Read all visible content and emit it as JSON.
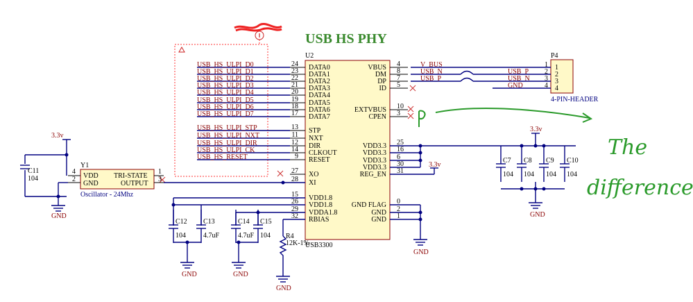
{
  "title": "USB HS PHY",
  "annotation": {
    "lines": [
      "The",
      "difference!"
    ],
    "marker": "p"
  },
  "u2": {
    "ref": "U2",
    "part": "USB3300",
    "left_pins": [
      {
        "num": "24",
        "name": "DATA0",
        "net": "USB_HS_ULPI_D0"
      },
      {
        "num": "23",
        "name": "DATA1",
        "net": "USB_HS_ULPI_D1"
      },
      {
        "num": "22",
        "name": "DATA2",
        "net": "USB_HS_ULPI_D2"
      },
      {
        "num": "21",
        "name": "DATA3",
        "net": "USB_HS_ULPI_D3"
      },
      {
        "num": "20",
        "name": "DATA4",
        "net": "USB_HS_ULPI_D4"
      },
      {
        "num": "19",
        "name": "DATA5",
        "net": "USB_HS_ULPI_D5"
      },
      {
        "num": "18",
        "name": "DATA6",
        "net": "USB_HS_ULPI_D6"
      },
      {
        "num": "17",
        "name": "DATA7",
        "net": "USB_HS_ULPI_D7"
      },
      {
        "num": "13",
        "name": "STP",
        "net": "USB_HS_ULPI_STP"
      },
      {
        "num": "11",
        "name": "NXT",
        "net": "USB_HS_ULPI_NXT"
      },
      {
        "num": "12",
        "name": "DIR",
        "net": "USB_HS_ULPI_DIR"
      },
      {
        "num": "14",
        "name": "CLKOUT",
        "net": "USB_HS_ULPI_CK"
      },
      {
        "num": "9",
        "name": "RESET",
        "net": "USB_HS_RESET"
      },
      {
        "num": "27",
        "name": "XO",
        "net": ""
      },
      {
        "num": "28",
        "name": "XI",
        "net": ""
      },
      {
        "num": "15",
        "name": "VDD1.8",
        "net": ""
      },
      {
        "num": "26",
        "name": "VDD1.8",
        "net": ""
      },
      {
        "num": "29",
        "name": "VDDA1.8",
        "net": ""
      },
      {
        "num": "32",
        "name": "RBIAS",
        "net": ""
      }
    ],
    "right_pins": [
      {
        "num": "4",
        "name": "VBUS",
        "net": "V_BUS"
      },
      {
        "num": "8",
        "name": "DM",
        "net": "USB_N"
      },
      {
        "num": "7",
        "name": "DP",
        "net": "USB_P"
      },
      {
        "num": "5",
        "name": "ID",
        "net": ""
      },
      {
        "num": "10",
        "name": "EXTVBUS",
        "net": ""
      },
      {
        "num": "3",
        "name": "CPEN",
        "net": ""
      },
      {
        "num": "25",
        "name": "VDD3.3",
        "net": ""
      },
      {
        "num": "16",
        "name": "VDD3.3",
        "net": ""
      },
      {
        "num": "6",
        "name": "VDD3.3",
        "net": ""
      },
      {
        "num": "30",
        "name": "VDD3.3",
        "net": ""
      },
      {
        "num": "31",
        "name": "REG_EN",
        "net": ""
      },
      {
        "num": "0",
        "name": "GND FLAG",
        "net": ""
      },
      {
        "num": "2",
        "name": "GND",
        "net": ""
      },
      {
        "num": "1",
        "name": "GND",
        "net": ""
      }
    ]
  },
  "p4": {
    "ref": "P4",
    "part": "4-PIN-HEADER",
    "pins": [
      {
        "num": "1",
        "pin": "1",
        "net": ""
      },
      {
        "num": "2",
        "pin": "2",
        "net": "USB_P"
      },
      {
        "num": "3",
        "pin": "3",
        "net": "USB_N"
      },
      {
        "num": "4",
        "pin": "4",
        "net": "GND"
      }
    ]
  },
  "y1": {
    "ref": "Y1",
    "part": "Oscillator - 24Mhz",
    "vdd": "VDD",
    "gnd": "GND",
    "tri": "TRI-STATE",
    "out": "OUTPUT",
    "pin_vdd": "4",
    "pin_gnd": "2",
    "pin_tri": "1",
    "pin_out": "3"
  },
  "c11": {
    "ref": "C11",
    "value": "104"
  },
  "caps_bottom": [
    {
      "ref": "C12",
      "value": "104"
    },
    {
      "ref": "C13",
      "value": "4.7uF"
    },
    {
      "ref": "C14",
      "value": "4.7uF"
    },
    {
      "ref": "C15",
      "value": "104"
    }
  ],
  "caps_right": [
    {
      "ref": "C7",
      "value": "104"
    },
    {
      "ref": "C8",
      "value": "104"
    },
    {
      "ref": "C9",
      "value": "104"
    },
    {
      "ref": "C10",
      "value": "104"
    }
  ],
  "r4": {
    "ref": "R4",
    "value": "12K-1%"
  },
  "power": {
    "v33": "3.3v",
    "gnd": "GND"
  }
}
